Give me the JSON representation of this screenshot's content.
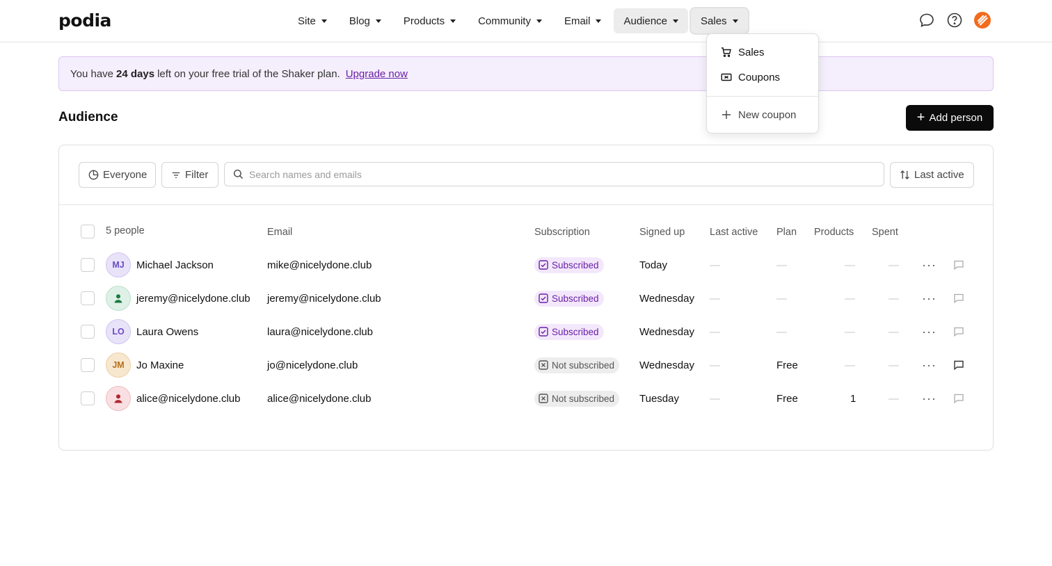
{
  "app": {
    "logo": "podia"
  },
  "nav": {
    "items": [
      {
        "label": "Site"
      },
      {
        "label": "Blog"
      },
      {
        "label": "Products"
      },
      {
        "label": "Community"
      },
      {
        "label": "Email"
      },
      {
        "label": "Audience"
      },
      {
        "label": "Sales"
      }
    ],
    "active": "Audience",
    "open": "Sales",
    "icons": [
      "chat-icon",
      "help-icon",
      "profile-icon"
    ]
  },
  "sales_menu": {
    "items": [
      {
        "label": "Sales",
        "icon": "cart-icon"
      },
      {
        "label": "Coupons",
        "icon": "coupon-icon"
      }
    ],
    "new_coupon": "New coupon"
  },
  "banner": {
    "text_before": "You have",
    "days": "24 days",
    "text_after": "left on your free trial of the Shaker plan.",
    "link": "Upgrade now"
  },
  "page": {
    "title": "Audience",
    "add_button": "Add person"
  },
  "toolbar": {
    "segment": "Everyone",
    "filter": "Filter",
    "search_placeholder": "Search names and emails",
    "sort": "Last active"
  },
  "table": {
    "count_label": "5 people",
    "columns": {
      "email": "Email",
      "subscription": "Subscription",
      "signed_up": "Signed up",
      "last_active": "Last active",
      "plan": "Plan",
      "products": "Products",
      "spent": "Spent"
    },
    "empty": "—",
    "rows": [
      {
        "initials": "MJ",
        "name": "Michael Jackson",
        "email": "mike@nicelydone.club",
        "subscription": "Subscribed",
        "signed_up": "Today",
        "last_active": "—",
        "plan": "—",
        "products": "—",
        "spent": "—",
        "actions": "···"
      },
      {
        "initials": "",
        "name": "jeremy@nicelydone.club",
        "email": "jeremy@nicelydone.club",
        "subscription": "Subscribed",
        "signed_up": "Wednesday",
        "last_active": "—",
        "plan": "—",
        "products": "—",
        "spent": "—",
        "actions": "···"
      },
      {
        "initials": "LO",
        "name": "Laura Owens",
        "email": "laura@nicelydone.club",
        "subscription": "Subscribed",
        "signed_up": "Wednesday",
        "last_active": "—",
        "plan": "—",
        "products": "—",
        "spent": "—",
        "actions": "···"
      },
      {
        "initials": "JM",
        "name": "Jo Maxine",
        "email": "jo@nicelydone.club",
        "subscription": "Not subscribed",
        "signed_up": "Wednesday",
        "last_active": "—",
        "plan": "Free",
        "products": "—",
        "spent": "—",
        "actions": "···"
      },
      {
        "initials": "",
        "name": "alice@nicelydone.club",
        "email": "alice@nicelydone.club",
        "subscription": "Not subscribed",
        "signed_up": "Tuesday",
        "last_active": "—",
        "plan": "Free",
        "products": "1",
        "spent": "—",
        "actions": "···"
      }
    ]
  },
  "colors": {
    "accent": "#6a1fa8",
    "banner_bg": "#f5eefc",
    "add_button_bg": "#0b0b0b",
    "avatar_mj": "#e9e3fa",
    "avatar_jeremy": "#dff1e7",
    "avatar_lo": "#e9e3fa",
    "avatar_jm": "#f8e7cf",
    "avatar_alice": "#f9dfe1"
  }
}
